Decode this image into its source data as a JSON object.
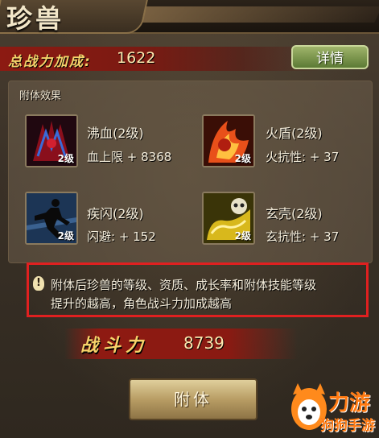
{
  "header": {
    "title": "珍兽"
  },
  "summary": {
    "total_label": "总战力加成:",
    "total_value": "1622",
    "detail_button": "详情"
  },
  "effects": {
    "header": "附体效果",
    "skills": [
      {
        "name": "沸血(2级)",
        "stat": "血上限 + 8368",
        "level": "2级",
        "icon": "blood-claw-icon"
      },
      {
        "name": "火盾(2级)",
        "stat": "火抗性:  + 37",
        "level": "2级",
        "icon": "fire-shield-icon"
      },
      {
        "name": "疾闪(2级)",
        "stat": "闪避:  + 152",
        "level": "2级",
        "icon": "dash-figure-icon"
      },
      {
        "name": "玄壳(2级)",
        "stat": "玄抗性:  + 37",
        "level": "2级",
        "icon": "skull-shell-icon"
      }
    ]
  },
  "tip": {
    "line1": "附体后珍兽的等级、资质、成长率和附体技能等级",
    "line2": "提升的越高，角色战斗力加成越高"
  },
  "power": {
    "label": "战斗力",
    "value": "8739"
  },
  "actions": {
    "attach_button": "附体"
  },
  "watermark": {
    "brand_top": "力游",
    "brand_bottom": "狗狗手游"
  },
  "colors": {
    "accent_red": "#e02020",
    "gold": "#f5d36b",
    "button_green": "#7a9448"
  }
}
